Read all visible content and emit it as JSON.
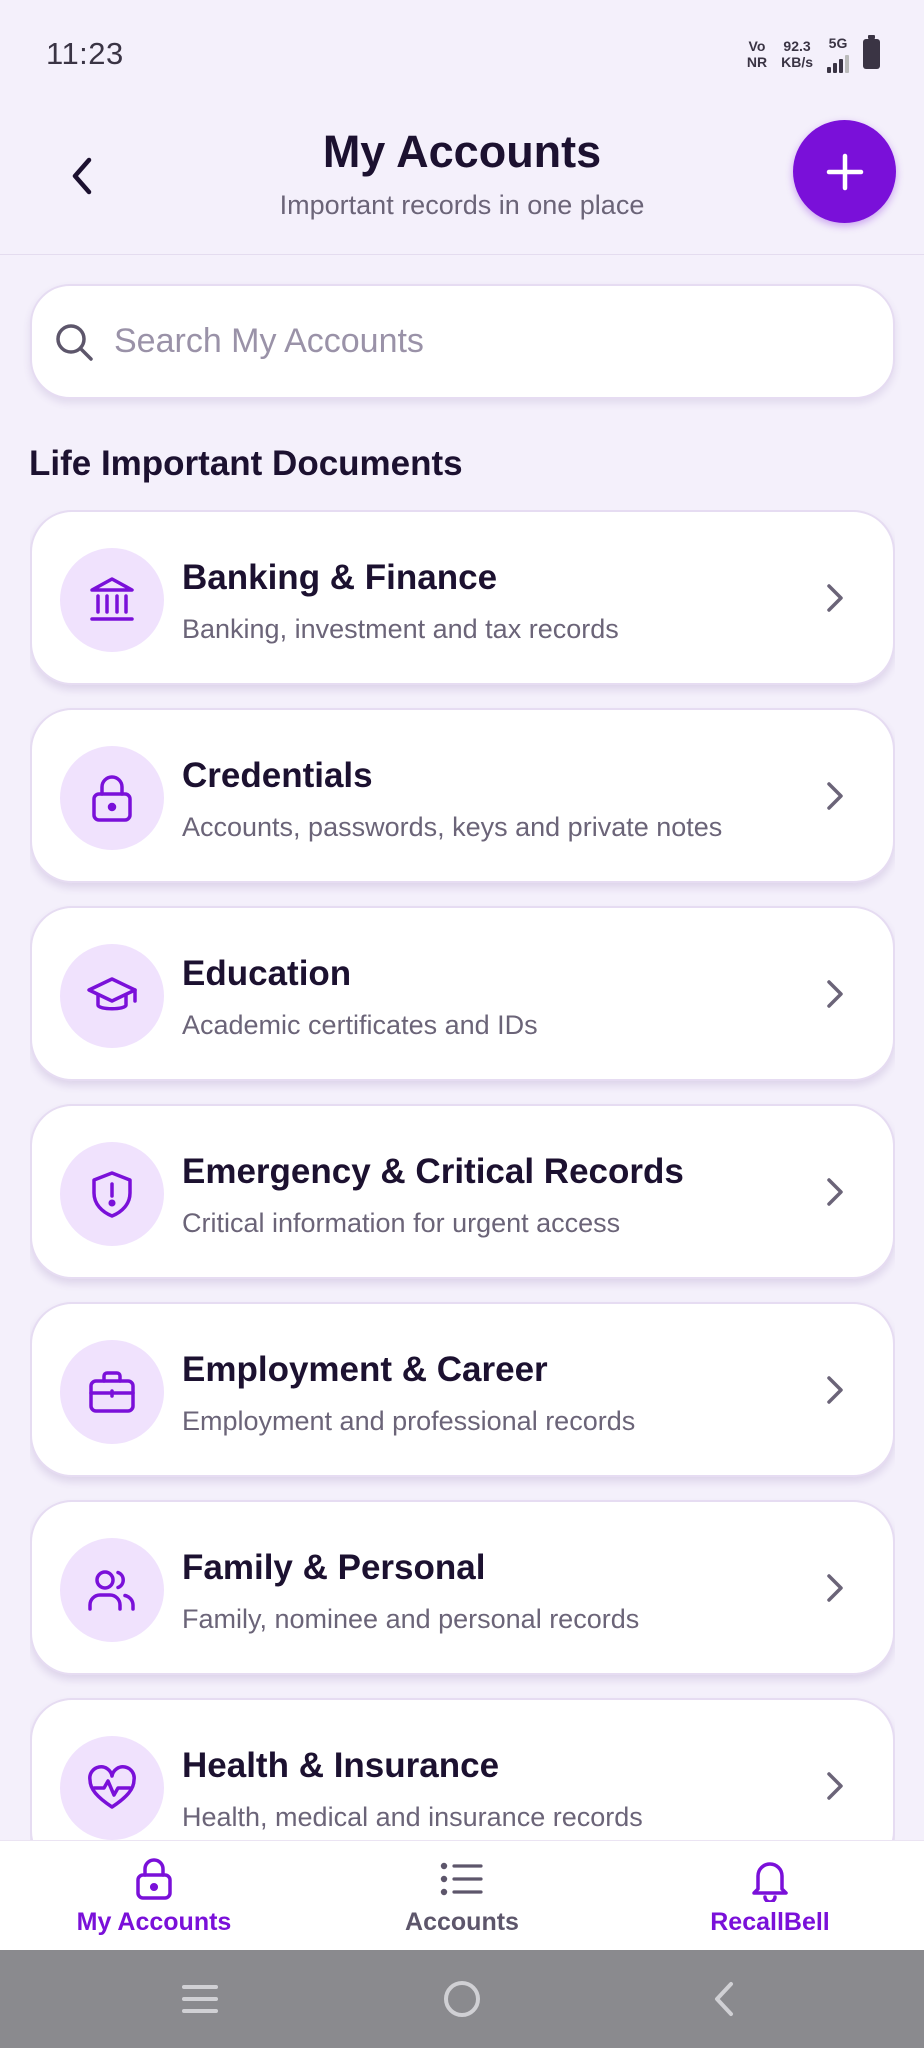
{
  "status_bar": {
    "time": "11:23",
    "volte_top": "Vo",
    "volte_bottom": "NR",
    "speed_top": "92.3",
    "speed_bottom": "KB/s",
    "network": "5G"
  },
  "header": {
    "title": "My Accounts",
    "subtitle": "Important records in one place",
    "back_icon": "chevron-left-icon",
    "add_icon": "plus-icon"
  },
  "search": {
    "placeholder": "Search My Accounts",
    "value": ""
  },
  "section": {
    "title": "Life Important Documents"
  },
  "categories": [
    {
      "title": "Banking & Finance",
      "subtitle": "Banking, investment and tax records",
      "icon": "bank-icon"
    },
    {
      "title": "Credentials",
      "subtitle": "Accounts, passwords, keys and private notes",
      "icon": "lock-icon"
    },
    {
      "title": "Education",
      "subtitle": "Academic certificates and IDs",
      "icon": "graduation-cap-icon"
    },
    {
      "title": "Emergency & Critical Records",
      "subtitle": "Critical information for urgent access",
      "icon": "shield-alert-icon"
    },
    {
      "title": "Employment & Career",
      "subtitle": "Employment and professional records",
      "icon": "briefcase-icon"
    },
    {
      "title": "Family & Personal",
      "subtitle": "Family, nominee and personal records",
      "icon": "users-icon"
    },
    {
      "title": "Health & Insurance",
      "subtitle": "Health, medical and insurance records",
      "icon": "heart-pulse-icon"
    }
  ],
  "bottom_nav": [
    {
      "label": "My Accounts",
      "icon": "lock-icon",
      "active": true
    },
    {
      "label": "Accounts",
      "icon": "list-icon",
      "active": false
    },
    {
      "label": "RecallBell",
      "icon": "bell-icon",
      "active": true
    }
  ],
  "colors": {
    "accent": "#7a10d9",
    "background": "#f4f0fb",
    "icon_bg": "#f0e2fd",
    "inactive": "#5d566b"
  }
}
